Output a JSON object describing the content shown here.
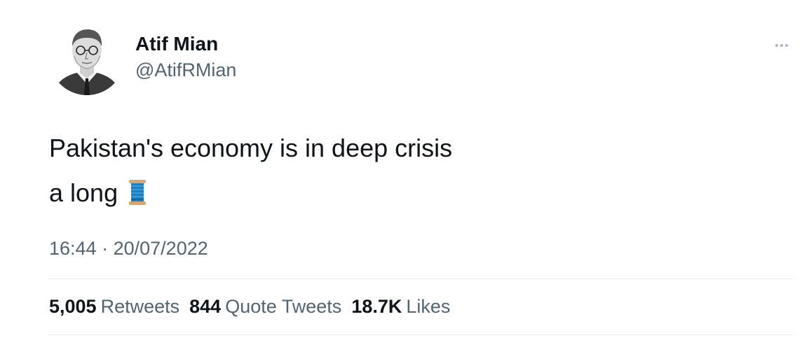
{
  "author": {
    "display_name": "Atif Mian",
    "handle": "@AtifRMian",
    "avatar_icon": "portrait-sketch-avatar"
  },
  "more_menu_icon": "more-horizontal-icon",
  "tweet": {
    "lines": [
      "Pakistan's economy is in deep crisis",
      "a long"
    ],
    "emoji": "thread-spool-emoji",
    "time": "16:44",
    "separator": "·",
    "date": "20/07/2022"
  },
  "stats": [
    {
      "count": "5,005",
      "label": "Retweets"
    },
    {
      "count": "844",
      "label": "Quote Tweets"
    },
    {
      "count": "18.7K",
      "label": "Likes"
    }
  ],
  "colors": {
    "text_primary": "#0f1419",
    "text_secondary": "#536471",
    "divider": "#e7ebee",
    "spool_thread": "#1d7fc4",
    "spool_wood": "#d9a673"
  }
}
